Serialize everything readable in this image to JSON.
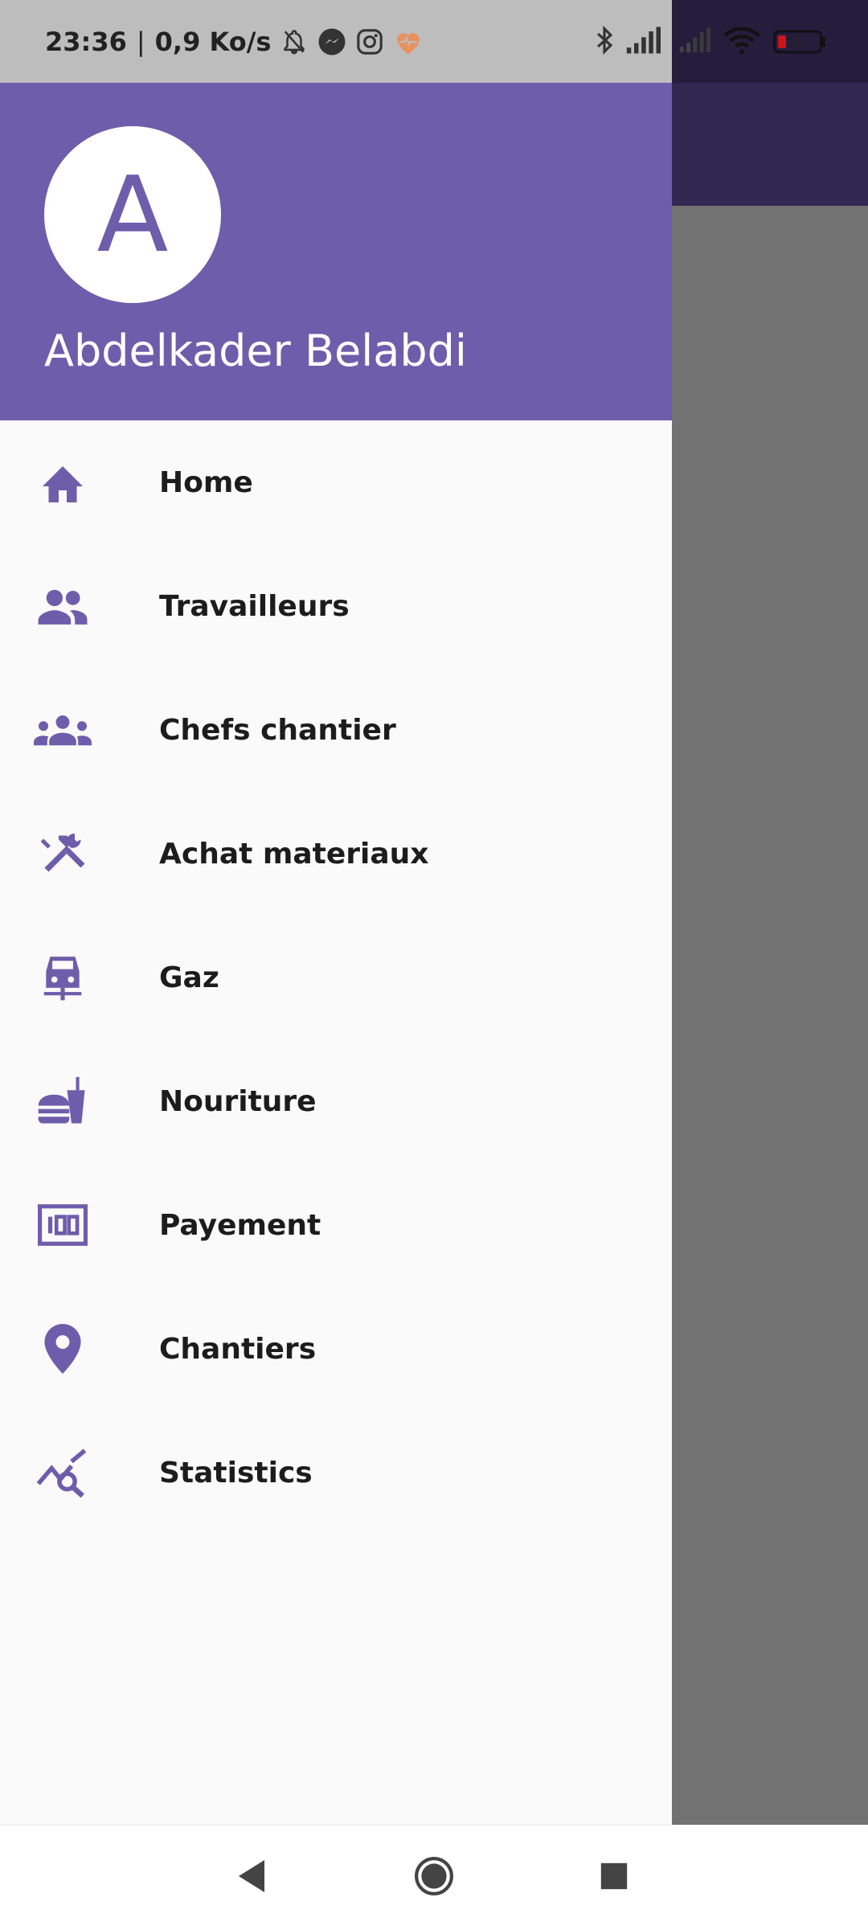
{
  "status_bar": {
    "time": "23:36",
    "separator": "|",
    "speed": "0,9 Ko/s",
    "battery_level": "18",
    "icons": [
      "bell-off-icon",
      "messenger-icon",
      "instagram-icon",
      "heart-pulse-icon",
      "bluetooth-icon",
      "signal-icon",
      "signal-weak-icon",
      "wifi-icon",
      "battery-icon"
    ]
  },
  "drawer": {
    "avatar_letter": "A",
    "user_name": "Abdelkader Belabdi",
    "items": [
      {
        "label": "Home",
        "icon": "home-icon"
      },
      {
        "label": "Travailleurs",
        "icon": "people-icon"
      },
      {
        "label": "Chefs chantier",
        "icon": "groups-icon"
      },
      {
        "label": "Achat materiaux",
        "icon": "tools-icon"
      },
      {
        "label": "Gaz",
        "icon": "car-icon"
      },
      {
        "label": "Nouriture",
        "icon": "fastfood-icon"
      },
      {
        "label": "Payement",
        "icon": "payment-icon"
      },
      {
        "label": "Chantiers",
        "icon": "location-pin-icon"
      },
      {
        "label": "Statistics",
        "icon": "query-stats-icon"
      }
    ]
  },
  "navbar": {
    "buttons": [
      "back-icon",
      "home-circle-icon",
      "recents-icon"
    ]
  },
  "colors": {
    "accent": "#6e5dab",
    "scrim": "#727272",
    "status_bar": "#bdbdbd"
  }
}
